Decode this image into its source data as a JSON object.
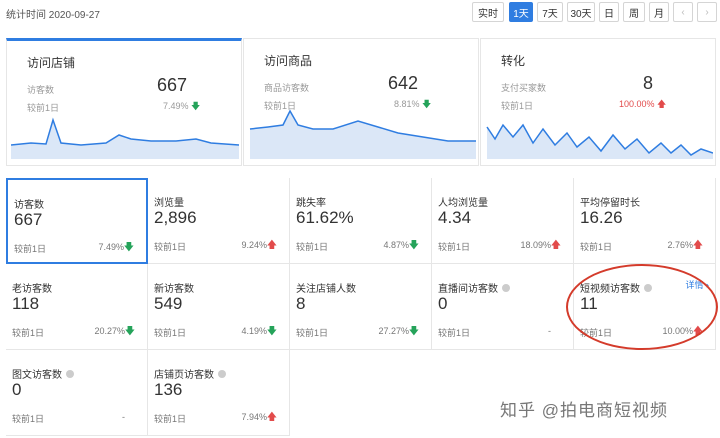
{
  "header": {
    "stat_time": "统计时间 2020-09-27",
    "range_buttons": [
      "实时",
      "1天",
      "7天",
      "30天",
      "日",
      "周",
      "月"
    ],
    "prev_icon": "chevron-left-icon",
    "next_icon": "chevron-right-icon",
    "prev": "‹",
    "next": "›"
  },
  "overview": [
    {
      "title": "访问店铺",
      "sub": "访客数",
      "value": "667",
      "cmp": "较前1日",
      "pct": "7.49%",
      "trend": "down"
    },
    {
      "title": "访问商品",
      "sub": "商品访客数",
      "value": "642",
      "cmp": "较前1日",
      "pct": "8.81%",
      "trend": "down"
    },
    {
      "title": "转化",
      "sub": "支付买家数",
      "value": "8",
      "cmp": "较前1日",
      "pct": "100.00%",
      "trend": "up"
    }
  ],
  "metrics": [
    {
      "label": "访客数",
      "value": "667",
      "cmp": "较前1日",
      "pct": "7.49%",
      "trend": "down"
    },
    {
      "label": "浏览量",
      "value": "2,896",
      "cmp": "较前1日",
      "pct": "9.24%",
      "trend": "up"
    },
    {
      "label": "跳失率",
      "value": "61.62%",
      "cmp": "较前1日",
      "pct": "4.87%",
      "trend": "down"
    },
    {
      "label": "人均浏览量",
      "value": "4.34",
      "cmp": "较前1日",
      "pct": "18.09%",
      "trend": "up"
    },
    {
      "label": "平均停留时长",
      "value": "16.26",
      "cmp": "较前1日",
      "pct": "2.76%",
      "trend": "up"
    },
    {
      "label": "老访客数",
      "value": "118",
      "cmp": "较前1日",
      "pct": "20.27%",
      "trend": "down"
    },
    {
      "label": "新访客数",
      "value": "549",
      "cmp": "较前1日",
      "pct": "4.19%",
      "trend": "down"
    },
    {
      "label": "关注店铺人数",
      "value": "8",
      "cmp": "较前1日",
      "pct": "27.27%",
      "trend": "down"
    },
    {
      "label": "直播间访客数",
      "value": "0",
      "cmp": "较前1日",
      "pct": "-",
      "trend": ""
    },
    {
      "label": "短视频访客数",
      "value": "11",
      "cmp": "较前1日",
      "pct": "10.00%",
      "trend": "up",
      "detail": "详情 ›"
    },
    {
      "label": "图文访客数",
      "value": "0",
      "cmp": "较前1日",
      "pct": "-",
      "trend": ""
    },
    {
      "label": "店铺页访客数",
      "value": "136",
      "cmp": "较前1日",
      "pct": "7.94%",
      "trend": "up"
    }
  ],
  "arrows": {
    "up": "🡅",
    "down": "🡇"
  },
  "watermark": "知乎 @拍电商短视频",
  "colors": {
    "accent": "#2f7de1",
    "up": "#e24b4b",
    "down": "#25a35a",
    "highlight_circle": "#d43b2b"
  }
}
